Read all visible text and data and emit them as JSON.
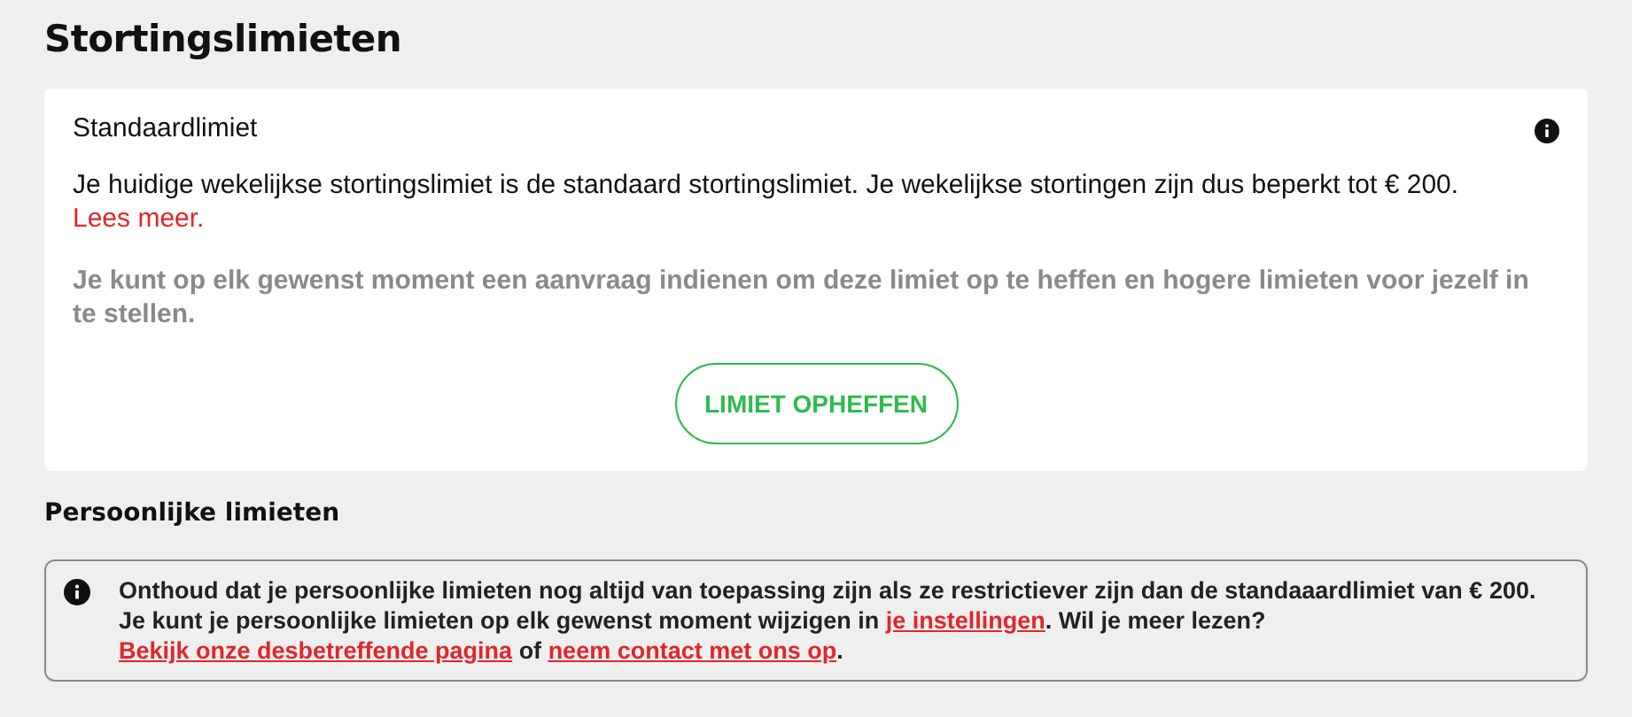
{
  "page_title": "Stortingslimieten",
  "standard_card": {
    "title": "Standaardlimiet",
    "body": [
      {
        "kind": "text",
        "text": "Je huidige wekelijkse stortingslimiet is de standaard stortingslimiet. Je wekelijkse stortingen zijn dus beperkt tot € 200. "
      },
      {
        "kind": "link",
        "text": "Lees meer."
      }
    ],
    "note": "Je kunt op elk gewenst moment een aanvraag indienen om deze limiet op te heffen en hogere limieten voor jezelf in te stellen.",
    "button": "LIMIET OPHEFFEN"
  },
  "personal_section": {
    "title": "Persoonlijke limieten",
    "notice": [
      {
        "kind": "text",
        "text": "Onthoud dat je persoonlijke limieten nog altijd van toepassing zijn als ze restrictiever zijn dan de standaaardlimiet van € 200. Je kunt je persoonlijke limieten op elk gewenst moment wijzigen in "
      },
      {
        "kind": "link",
        "text": "je instellingen"
      },
      {
        "kind": "text",
        "text": ". Wil je meer lezen? "
      },
      {
        "kind": "link",
        "text": "Bekijk onze desbetreffende pagina"
      },
      {
        "kind": "text",
        "text": " of "
      },
      {
        "kind": "link",
        "text": "neem contact met ons op"
      },
      {
        "kind": "text",
        "text": "."
      }
    ]
  }
}
